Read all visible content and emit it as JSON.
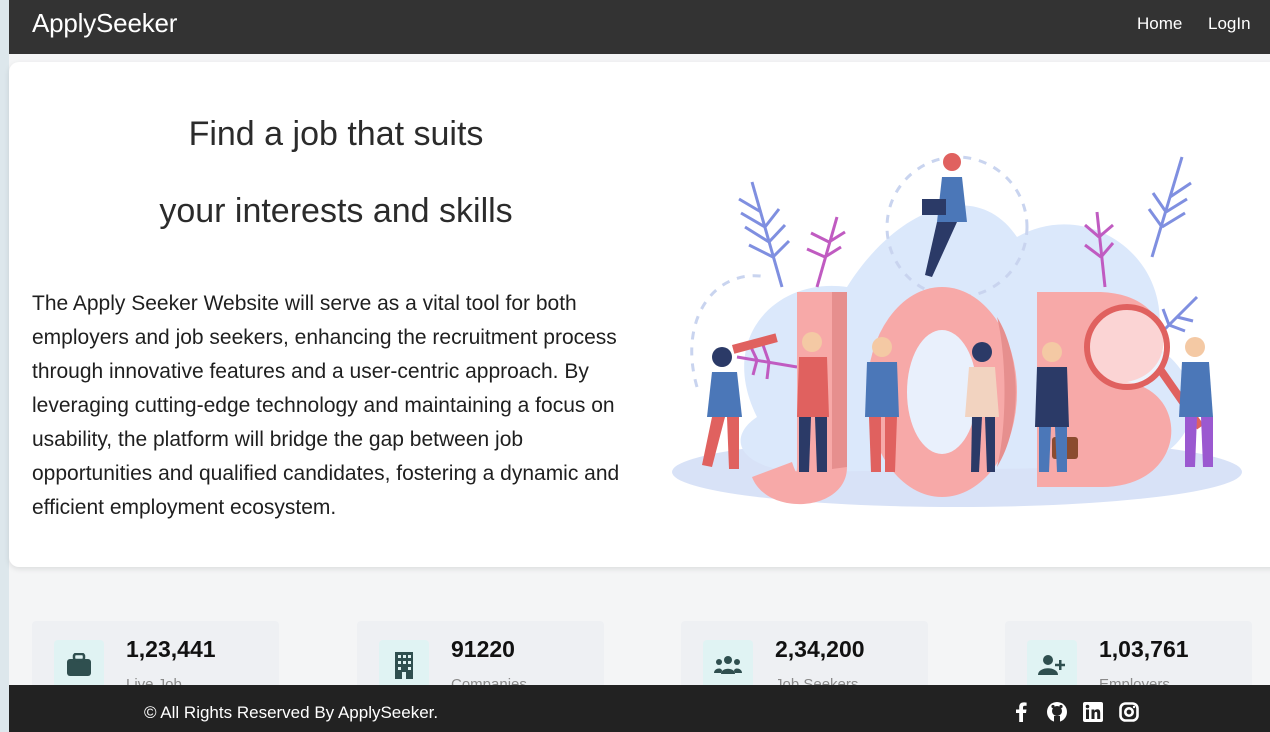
{
  "navbar": {
    "brand": "ApplySeeker",
    "links": [
      {
        "label": "Home"
      },
      {
        "label": "LogIn"
      }
    ]
  },
  "hero": {
    "title_line1": "Find a job that suits",
    "title_line2": "your interests and skills",
    "description": "The Apply Seeker Website will serve as a vital tool for both employers and job seekers, enhancing the recruitment process through innovative features and a user-centric approach. By leveraging cutting-edge technology and maintaining a focus on usability, the platform will bridge the gap between job opportunities and qualified candidates, fostering a dynamic and efficient employment ecosystem.",
    "illustration_text": "JOB"
  },
  "stats": [
    {
      "value": "1,23,441",
      "label": "Live Job",
      "icon": "briefcase-icon"
    },
    {
      "value": "91220",
      "label": "Companies",
      "icon": "building-icon"
    },
    {
      "value": "2,34,200",
      "label": "Job Seekers",
      "icon": "users-icon"
    },
    {
      "value": "1,03,761",
      "label": "Employers",
      "icon": "user-plus-icon"
    }
  ],
  "footer": {
    "copyright": "© All Rights Reserved By ApplySeeker.",
    "social": [
      "facebook-icon",
      "github-icon",
      "linkedin-icon",
      "instagram-icon"
    ]
  },
  "colors": {
    "navbar_bg": "#333333",
    "footer_bg": "#222222",
    "icon_teal": "#2f4f4f",
    "icon_box_bg": "#e0f3f3",
    "illustration_pink": "#f7a9a8"
  }
}
